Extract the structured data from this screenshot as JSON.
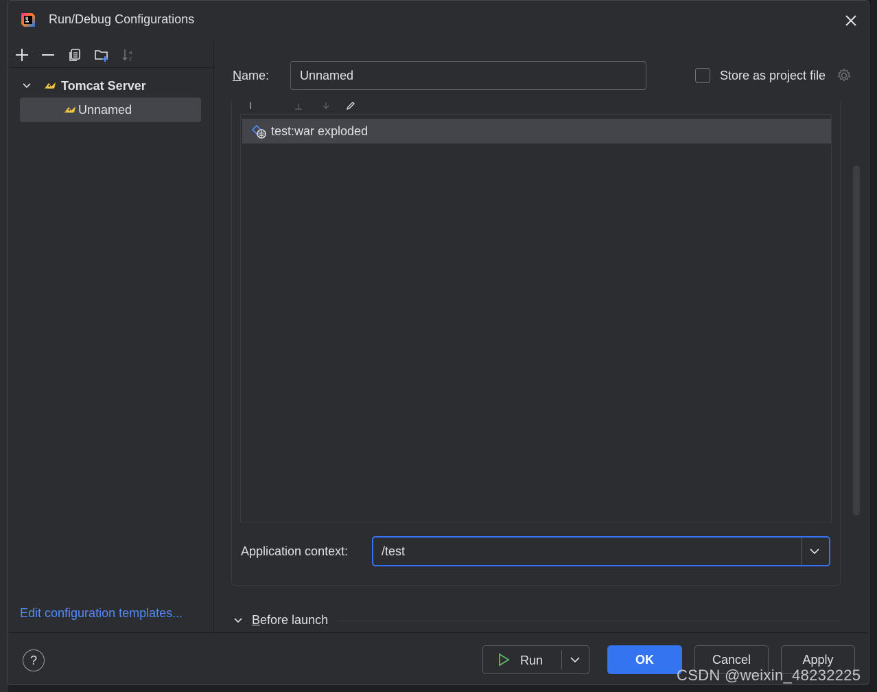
{
  "dialog": {
    "title": "Run/Debug Configurations"
  },
  "toolbar": {
    "add": "plus-icon",
    "remove": "minus-icon",
    "copy": "copy-icon",
    "folder": "new-folder-icon",
    "sort": "sort-alpha-icon"
  },
  "tree": {
    "group_label": "Tomcat Server",
    "item_label": "Unnamed"
  },
  "left_footer": {
    "edit_templates": "Edit configuration templates..."
  },
  "form": {
    "name_label_u": "N",
    "name_label_rest": "ame:",
    "name_value": "Unnamed",
    "store_label": "Store as project file",
    "store_checked": false
  },
  "deployment": {
    "artifacts": [
      {
        "label": "test:war exploded"
      }
    ]
  },
  "context": {
    "label": "Application context:",
    "value": "/test"
  },
  "before_launch": {
    "label_u": "B",
    "label_rest": "efore launch"
  },
  "footer": {
    "help": "?",
    "run": "Run",
    "ok": "OK",
    "cancel": "Cancel",
    "apply": "Apply"
  },
  "watermark": "CSDN @weixin_48232225",
  "colors": {
    "accent": "#3574f0",
    "link": "#548af7",
    "panel": "#2b2d30",
    "selection": "#43454a"
  }
}
